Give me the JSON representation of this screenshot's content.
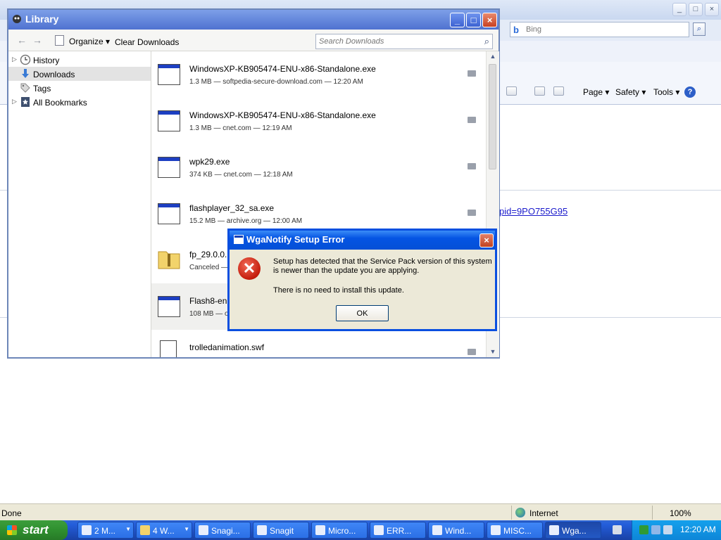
{
  "ie": {
    "search_placeholder": "Bing",
    "commands": {
      "page": "Page ▾",
      "safety": "Safety ▾",
      "tools": "Tools ▾"
    },
    "link_text": "pid=9PO755G95",
    "status_text": "Done",
    "zone": "Internet",
    "zoom": "100%"
  },
  "library": {
    "title": "Library",
    "toolbar": {
      "organize": "Organize ▾",
      "clear_downloads": "Clear Downloads"
    },
    "search_placeholder": "Search Downloads",
    "sidebar": [
      {
        "label": "History"
      },
      {
        "label": "Downloads"
      },
      {
        "label": "Tags"
      },
      {
        "label": "All Bookmarks"
      }
    ],
    "downloads": [
      {
        "name": "WindowsXP-KB905474-ENU-x86-Standalone.exe",
        "meta": "1.3 MB — softpedia-secure-download.com — 12:20 AM"
      },
      {
        "name": "WindowsXP-KB905474-ENU-x86-Standalone.exe",
        "meta": "1.3 MB — cnet.com — 12:19 AM"
      },
      {
        "name": "wpk29.exe",
        "meta": "374 KB — cnet.com — 12:18 AM"
      },
      {
        "name": "flashplayer_32_sa.exe",
        "meta": "15.2 MB — archive.org — 12:00 AM"
      },
      {
        "name": "fp_29.0.0.1",
        "meta": "Canceled —"
      },
      {
        "name": "Flash8-en.e",
        "meta": "108 MB — ol"
      },
      {
        "name": "trolledanimation.swf",
        "meta": ""
      }
    ]
  },
  "dialog": {
    "title": "WgaNotify Setup Error",
    "message1": "Setup has detected that the Service Pack version of this system is newer than the update you are applying.",
    "message2": "There is no need to install this update.",
    "ok_label": "OK"
  },
  "taskbar": {
    "start_label": "start",
    "buttons": [
      {
        "label": "2 M..."
      },
      {
        "label": "4 W..."
      },
      {
        "label": "Snagi..."
      },
      {
        "label": "Snagit"
      },
      {
        "label": "Micro..."
      },
      {
        "label": "ERR..."
      },
      {
        "label": "Wind..."
      },
      {
        "label": "MISC..."
      },
      {
        "label": "Wga..."
      }
    ],
    "clock": "12:20 AM"
  }
}
